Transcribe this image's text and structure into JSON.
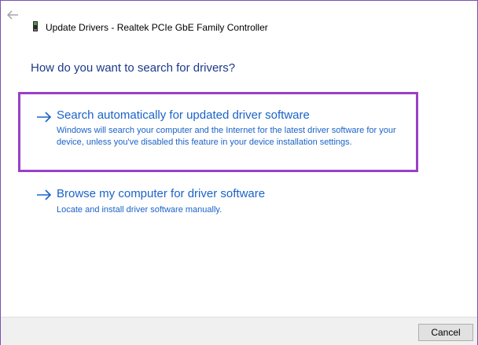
{
  "window": {
    "title": "Update Drivers - Realtek PCIe GbE Family Controller"
  },
  "heading": "How do you want to search for drivers?",
  "options": [
    {
      "title": "Search automatically for updated driver software",
      "description": "Windows will search your computer and the Internet for the latest driver software for your device, unless you've disabled this feature in your device installation settings."
    },
    {
      "title": "Browse my computer for driver software",
      "description": "Locate and install driver software manually."
    }
  ],
  "footer": {
    "cancel_label": "Cancel"
  },
  "colors": {
    "link": "#1a63c8",
    "heading": "#1c3a8a",
    "highlight_border": "#9b3fc7",
    "footer_bg": "#f0f0f0"
  },
  "icons": {
    "back": "back-arrow-icon",
    "device": "network-adapter-icon",
    "option_arrow": "right-arrow-icon"
  }
}
